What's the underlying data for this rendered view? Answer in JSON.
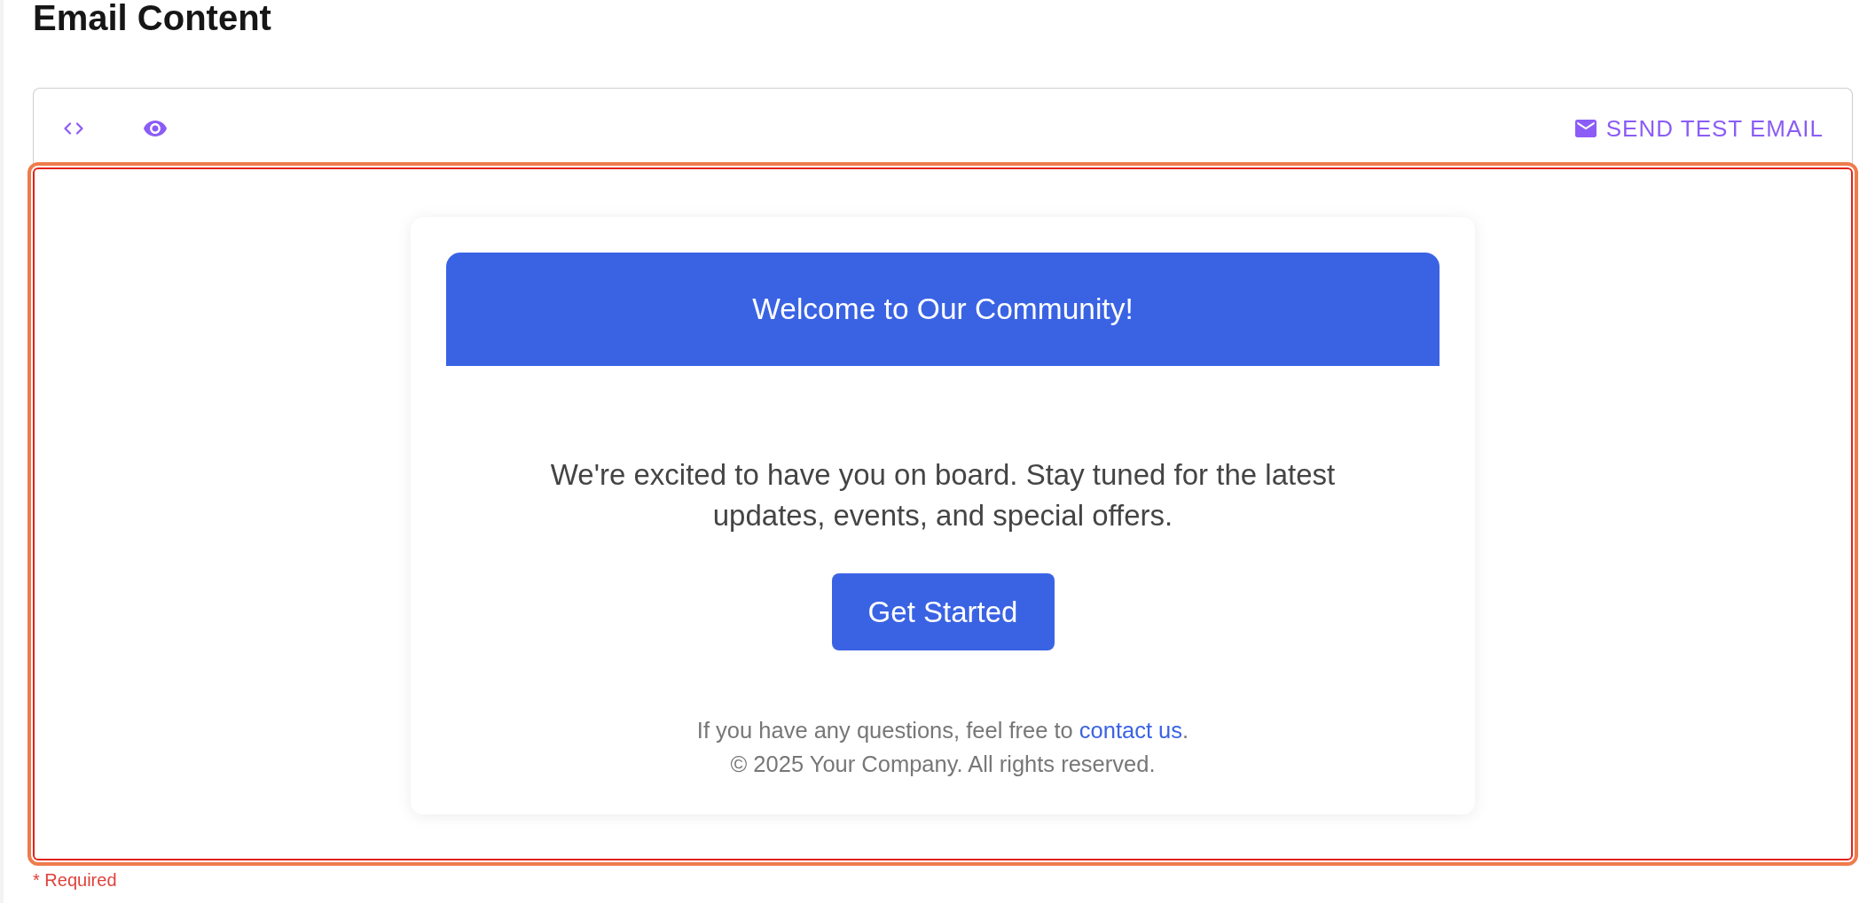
{
  "title": "Email Content",
  "editor": {
    "toolbar": {
      "view_buttons": [
        {
          "kind": "code"
        },
        {
          "kind": "preview"
        }
      ],
      "send_button": {
        "label": "SEND TEST EMAIL"
      }
    },
    "focused": true,
    "error": true,
    "email": {
      "header": "Welcome to Our Community!",
      "body": "We're excited to have you on board. Stay tuned for the latest updates, events, and special offers.",
      "button": "Get Started",
      "footer": {
        "text_before": "If you have any questions, feel free to ",
        "link": "contact us",
        "text_after": ".",
        "copyright": "© 2025 Your Company. All rights reserved."
      }
    }
  },
  "helper_text": "* Required"
}
